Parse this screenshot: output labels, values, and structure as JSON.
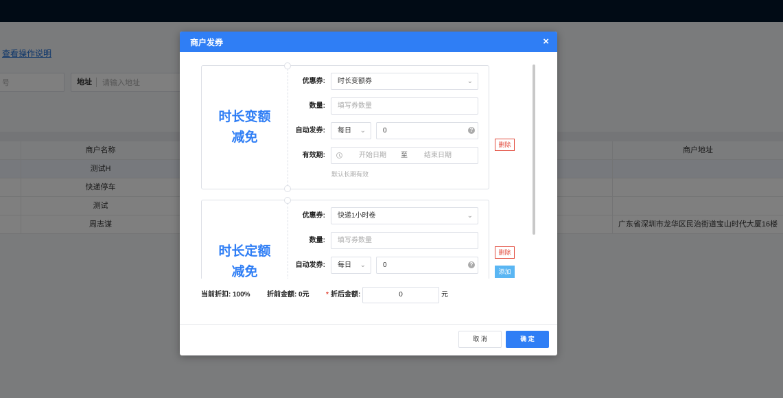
{
  "background": {
    "help_link": "查看操作说明",
    "input_a_placeholder": "号",
    "input_b_label": "地址",
    "input_b_placeholder": "请输入地址",
    "table": {
      "col_name": "商户名称",
      "col_address": "商户地址",
      "rows": [
        {
          "name": "测试H",
          "address": ""
        },
        {
          "name": "快递停车",
          "address": ""
        },
        {
          "name": "测试",
          "address": ""
        },
        {
          "name": "周志谋",
          "address": "广东省深圳市龙华区民治街道宝山时代大厦16楼"
        }
      ]
    }
  },
  "dialog": {
    "title": "商户发券",
    "close_symbol": "×",
    "labels": {
      "coupon": "优惠券:",
      "quantity": "数量:",
      "auto_issue": "自动发券:",
      "validity": "有效期:"
    },
    "cards": [
      {
        "title_line1": "时长变额",
        "title_line2": "减免",
        "coupon_value": "时长变额券",
        "quantity_placeholder": "填写券数量",
        "auto_period": "每日",
        "auto_count": "0",
        "date_start": "开始日期",
        "date_sep": "至",
        "date_end": "结束日期",
        "validity_hint": "默认长期有效",
        "delete_label": "删除"
      },
      {
        "title_line1": "时长定额",
        "title_line2": "减免",
        "coupon_value": "快递1小时卷",
        "quantity_placeholder": "填写券数量",
        "auto_period": "每日",
        "auto_count": "0",
        "delete_label": "删除",
        "add_label": "添加"
      }
    ],
    "summary": {
      "discount_label": "当前折扣:",
      "discount_value": "100%",
      "pre_amount_label": "折前金额:",
      "pre_amount_value": "0元",
      "required_mark": "*",
      "post_amount_label": "折后金额:",
      "post_amount_value": "0",
      "unit": "元"
    },
    "footer": {
      "cancel_label": "取 消",
      "ok_label": "确 定"
    }
  }
}
